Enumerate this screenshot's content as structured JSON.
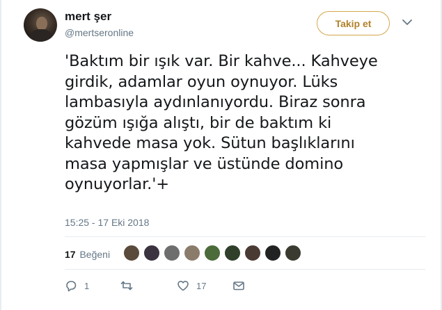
{
  "user": {
    "name": "mert şer",
    "handle": "@mertseronline"
  },
  "follow_button": "Takip et",
  "tweet": {
    "lines": [
      "'Baktım bir ışık var. Bir kahve... Kahveye",
      "girdik, adamlar oyun oynuyor. Lüks",
      "lambasıyla aydınlanıyordu. Biraz sonra",
      "gözüm ışığa alıştı, bir de baktım ki",
      "kahvede masa yok. Sütun başlıklarını",
      "masa yapmışlar ve üstünde domino",
      "oynuyorlar.'+"
    ],
    "timestamp": "15:25 - 17 Eki 2018"
  },
  "stats": {
    "likes_count": "17",
    "likes_label": "Beğeni"
  },
  "likers": [
    {
      "icon": "liker-avatar",
      "color": "#5a4a3c"
    },
    {
      "icon": "liker-avatar",
      "color": "#3b3340"
    },
    {
      "icon": "liker-avatar",
      "color": "#6e6e6e"
    },
    {
      "icon": "liker-avatar",
      "color": "#8a7b6b"
    },
    {
      "icon": "liker-avatar",
      "color": "#4b6b3a"
    },
    {
      "icon": "liker-avatar",
      "color": "#2f3f2a"
    },
    {
      "icon": "liker-avatar",
      "color": "#4a3a34"
    },
    {
      "icon": "liker-avatar",
      "color": "#222222"
    },
    {
      "icon": "liker-avatar",
      "color": "#3a3a30"
    }
  ],
  "actions": {
    "reply_count": "1",
    "retweet_count": "",
    "like_count": "17"
  },
  "colors": {
    "follow_border": "#d4a64a",
    "follow_text": "#b0822b",
    "secondary_text": "#657786",
    "primary_text": "#14171a"
  }
}
